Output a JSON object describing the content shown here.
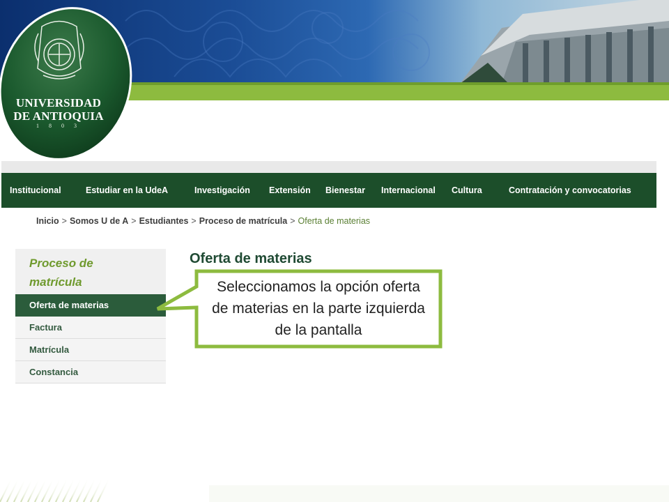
{
  "logo": {
    "university_line1": "UNIVERSIDAD",
    "university_line2": "DE ANTIOQUIA",
    "year": "1 8 0 3",
    "icon": "university-seal-icon"
  },
  "nav": {
    "items": [
      "Institucional",
      "Estudiar en la UdeA",
      "Investigación",
      "Extensión",
      "Bienestar",
      "Internacional",
      "Cultura",
      "Contratación y convocatorias"
    ]
  },
  "breadcrumb": {
    "items": [
      "Inicio",
      "Somos U de A",
      "Estudiantes",
      "Proceso de matrícula"
    ],
    "separator": ">",
    "current": "Oferta de materias"
  },
  "sidebar": {
    "title_line1": "Proceso de",
    "title_line2": "matrícula",
    "items": [
      "Oferta de materias",
      "Factura",
      "Matrícula",
      "Constancia"
    ],
    "active_index": 0
  },
  "main": {
    "title": "Oferta de materias"
  },
  "callout": {
    "line1": "Seleccionamos la opción oferta",
    "line2": "de materias en la parte izquierda",
    "line3": "de la pantalla"
  },
  "colors": {
    "nav_bg": "#1c4e2a",
    "accent_green": "#8dbb3f",
    "sidebar_active": "#2b5c3b",
    "callout_border": "#8dbb3f"
  }
}
